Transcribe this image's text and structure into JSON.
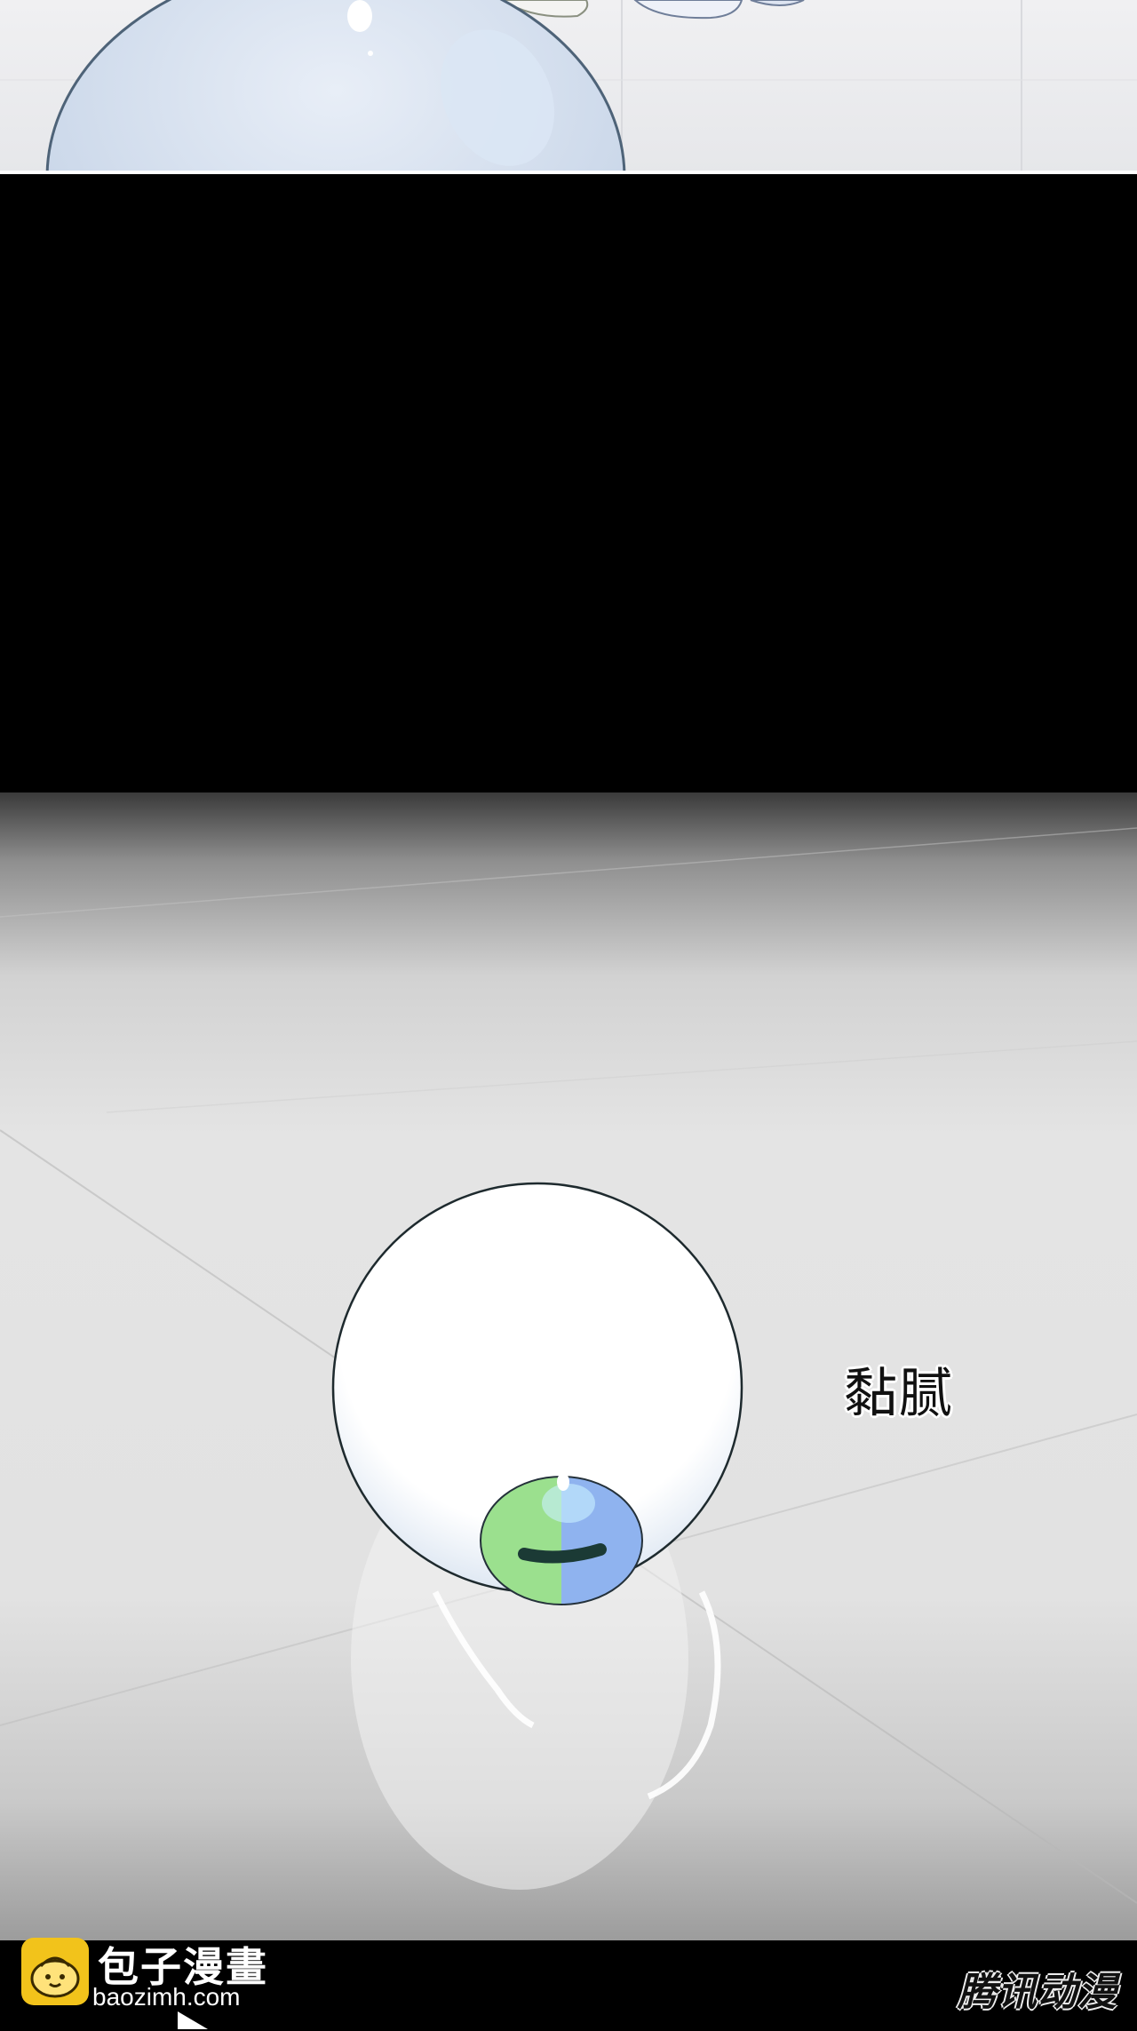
{
  "panels": {
    "top": {
      "scene": "upper-bubble"
    },
    "black": {
      "scene": "black-gap"
    },
    "floor": {
      "sfx_text": "黏腻"
    }
  },
  "footer": {
    "brand_title": "包子漫畫",
    "brand_url": "baozimh.com",
    "watermark": "腾讯动漫"
  },
  "colors": {
    "slime_body": "#ffffff",
    "slime_outline": "#1e2a2e",
    "eye_green": "#9be08e",
    "eye_blue": "#8fb3ef",
    "pupil": "#1b3a35",
    "floor_light": "#e2e2e2",
    "logo_yellow": "#f2c31b"
  }
}
